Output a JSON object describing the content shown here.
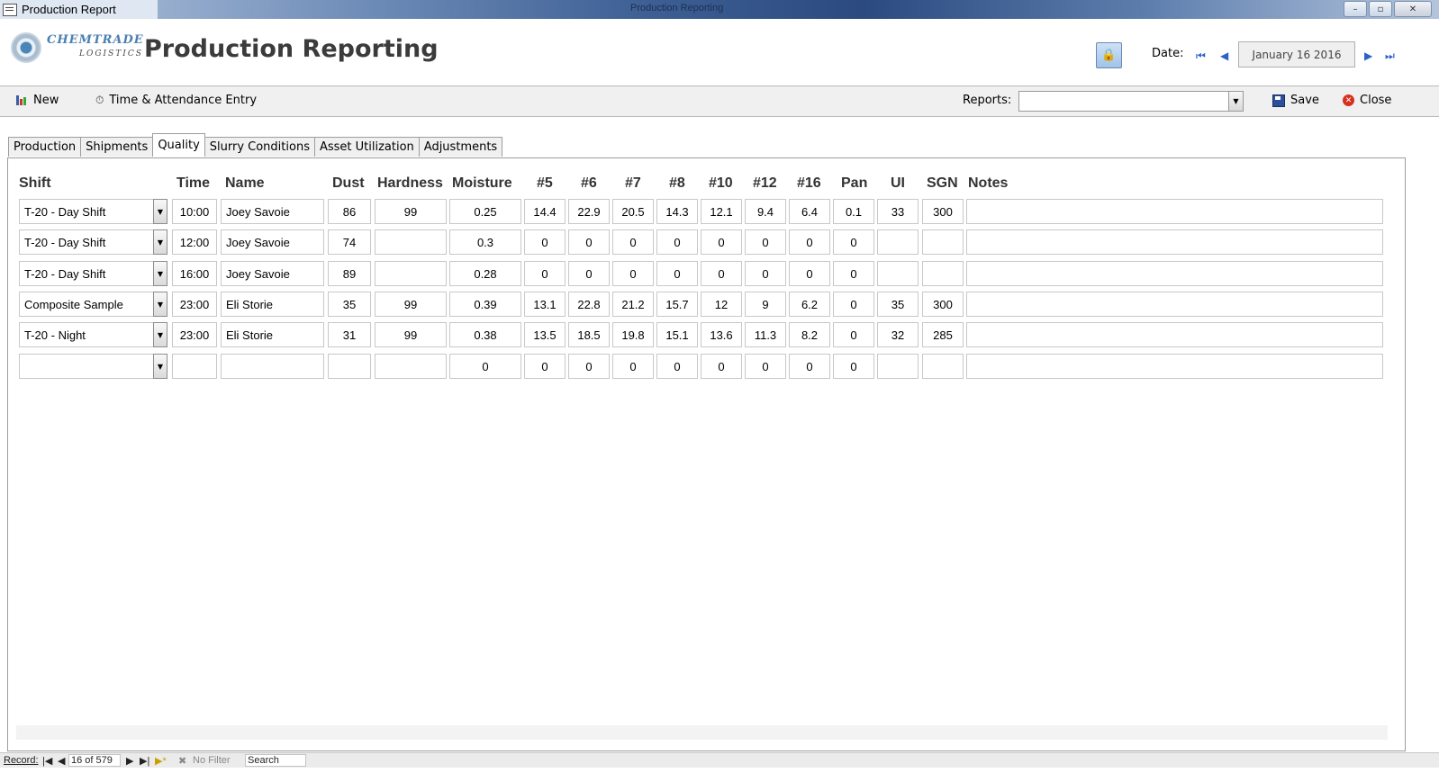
{
  "window": {
    "title": "Production Report",
    "center_title": "Production Reporting",
    "minimize": "–",
    "restore": "▫",
    "close": "✕"
  },
  "header": {
    "logo_line1": "CHEMTRADE",
    "logo_line2": "LOGISTICS",
    "app_title": "Production Reporting",
    "date_label": "Date:",
    "date_value": "January 16 2016"
  },
  "toolbar": {
    "new_label": "New",
    "time_attendance_label": "Time & Attendance Entry",
    "reports_label": "Reports:",
    "reports_value": "",
    "save_label": "Save",
    "close_label": "Close"
  },
  "tabs": [
    {
      "label": "Production",
      "active": false
    },
    {
      "label": "Shipments",
      "active": false
    },
    {
      "label": "Quality",
      "active": true
    },
    {
      "label": "Slurry Conditions",
      "active": false
    },
    {
      "label": "Asset Utilization",
      "active": false
    },
    {
      "label": "Adjustments",
      "active": false
    }
  ],
  "grid": {
    "columns": [
      "Shift",
      "Time",
      "Name",
      "Dust",
      "Hardness",
      "Moisture",
      "#5",
      "#6",
      "#7",
      "#8",
      "#10",
      "#12",
      "#16",
      "Pan",
      "UI",
      "SGN",
      "Notes"
    ],
    "rows": [
      [
        "T-20 - Day Shift",
        "10:00",
        "Joey Savoie",
        "86",
        "99",
        "0.25",
        "14.4",
        "22.9",
        "20.5",
        "14.3",
        "12.1",
        "9.4",
        "6.4",
        "0.1",
        "33",
        "300",
        ""
      ],
      [
        "T-20 - Day Shift",
        "12:00",
        "Joey Savoie",
        "74",
        "",
        "0.3",
        "0",
        "0",
        "0",
        "0",
        "0",
        "0",
        "0",
        "0",
        "",
        "",
        ""
      ],
      [
        "T-20 - Day Shift",
        "16:00",
        "Joey Savoie",
        "89",
        "",
        "0.28",
        "0",
        "0",
        "0",
        "0",
        "0",
        "0",
        "0",
        "0",
        "",
        "",
        ""
      ],
      [
        "Composite Sample",
        "23:00",
        "Eli Storie",
        "35",
        "99",
        "0.39",
        "13.1",
        "22.8",
        "21.2",
        "15.7",
        "12",
        "9",
        "6.2",
        "0",
        "35",
        "300",
        ""
      ],
      [
        "T-20 - Night",
        "23:00",
        "Eli Storie",
        "31",
        "99",
        "0.38",
        "13.5",
        "18.5",
        "19.8",
        "15.1",
        "13.6",
        "11.3",
        "8.2",
        "0",
        "32",
        "285",
        ""
      ],
      [
        "",
        "",
        "",
        "",
        "",
        "0",
        "0",
        "0",
        "0",
        "0",
        "0",
        "0",
        "0",
        "0",
        "",
        "",
        ""
      ]
    ]
  },
  "statusbar": {
    "record_label": "Record:",
    "record_value": "16 of 579",
    "filter_label": "No Filter",
    "search_label": "Search"
  }
}
